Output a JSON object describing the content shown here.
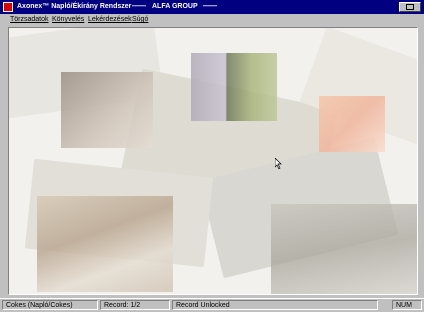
{
  "window": {
    "title": "Axonex™ Napló/Ékírány Rendszer",
    "separator": "——",
    "company": "ALFA GROUP"
  },
  "menu": {
    "items": [
      {
        "label": "Törzsadatok"
      },
      {
        "label": "Könyvelés"
      },
      {
        "label": "Lekérdezések"
      },
      {
        "label": "Súgó"
      }
    ]
  },
  "statusbar": {
    "company": "Cokes (Napló/Cokes)",
    "record": "Record: 1/2",
    "lock_status": "Record Unlocked",
    "num_lock": "NUM"
  },
  "icons": {
    "app": "app-icon",
    "restore": "restore-icon",
    "cursor": "mouse-cursor-icon"
  },
  "colors": {
    "titlebar": "#000080",
    "chrome": "#c0c0c0",
    "background": "#f3f1ee"
  }
}
